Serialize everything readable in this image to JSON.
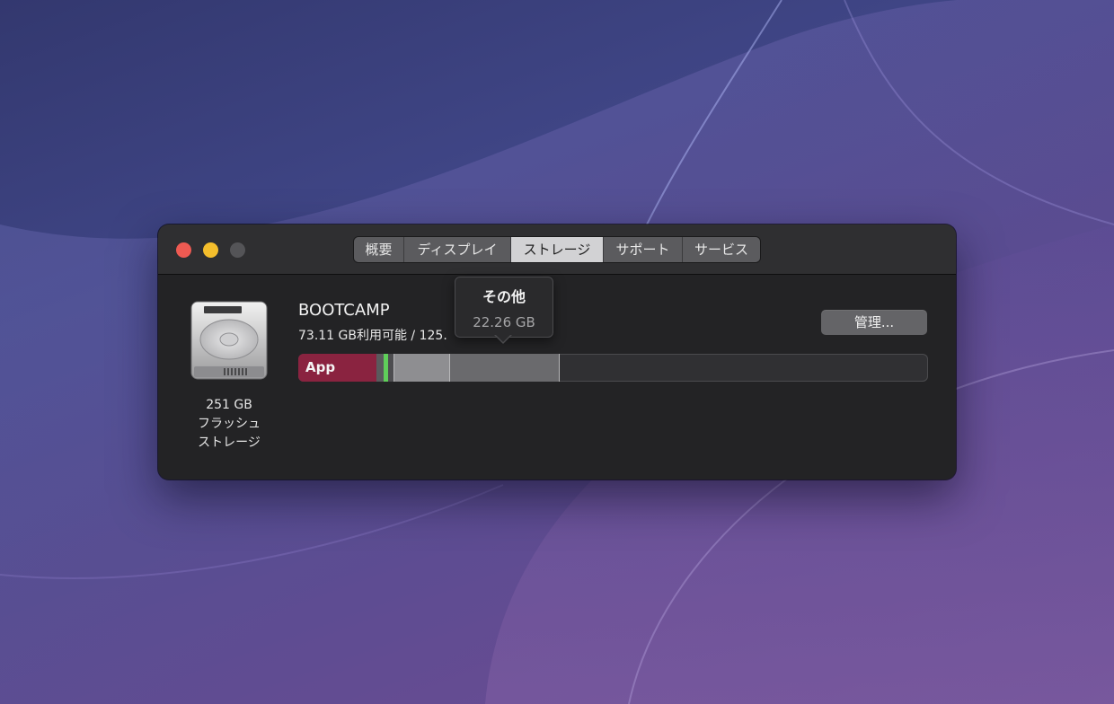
{
  "colors": {
    "app_segment": "#8a2340",
    "green_segment": "#5fcf5a",
    "docs_segment": "#8e8e91",
    "other_segment": "#6a6a6d",
    "free_space": "#303033",
    "tab_active": "#d2d2d4"
  },
  "window": {
    "tabs": [
      {
        "label": "概要"
      },
      {
        "label": "ディスプレイ"
      },
      {
        "label": "ストレージ"
      },
      {
        "label": "サポート"
      },
      {
        "label": "サービス"
      }
    ],
    "active_tab": "ストレージ"
  },
  "disk": {
    "icon": "hard-drive-icon",
    "capacity": "251 GB",
    "type_line1": "フラッシュ",
    "type_line2": "ストレージ"
  },
  "volume": {
    "name": "BOOTCAMP",
    "info_visible": "73.11 GB利用可能 / 125."
  },
  "manage_button": {
    "label": "管理..."
  },
  "storage_bar": {
    "app_label": "App",
    "segments": [
      {
        "name": "App",
        "color": "#8a2340"
      },
      {
        "name": "unlabeled-dark",
        "color": "#5a5a5d"
      },
      {
        "name": "unlabeled-green",
        "color": "#5fcf5a"
      },
      {
        "name": "unlabeled-light",
        "color": "#8e8e91"
      },
      {
        "name": "その他",
        "color": "#6a6a6d"
      }
    ]
  },
  "tooltip": {
    "title": "その他",
    "value": "22.26 GB"
  }
}
